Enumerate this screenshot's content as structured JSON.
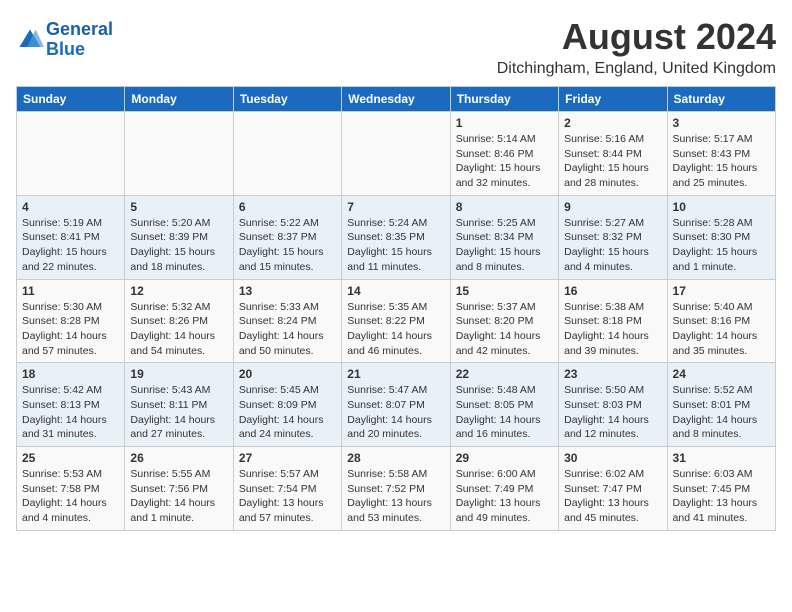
{
  "header": {
    "logo_line1": "General",
    "logo_line2": "Blue",
    "main_title": "August 2024",
    "subtitle": "Ditchingham, England, United Kingdom"
  },
  "calendar": {
    "days_of_week": [
      "Sunday",
      "Monday",
      "Tuesday",
      "Wednesday",
      "Thursday",
      "Friday",
      "Saturday"
    ],
    "weeks": [
      [
        {
          "day": "",
          "details": ""
        },
        {
          "day": "",
          "details": ""
        },
        {
          "day": "",
          "details": ""
        },
        {
          "day": "",
          "details": ""
        },
        {
          "day": "1",
          "details": "Sunrise: 5:14 AM\nSunset: 8:46 PM\nDaylight: 15 hours\nand 32 minutes."
        },
        {
          "day": "2",
          "details": "Sunrise: 5:16 AM\nSunset: 8:44 PM\nDaylight: 15 hours\nand 28 minutes."
        },
        {
          "day": "3",
          "details": "Sunrise: 5:17 AM\nSunset: 8:43 PM\nDaylight: 15 hours\nand 25 minutes."
        }
      ],
      [
        {
          "day": "4",
          "details": "Sunrise: 5:19 AM\nSunset: 8:41 PM\nDaylight: 15 hours\nand 22 minutes."
        },
        {
          "day": "5",
          "details": "Sunrise: 5:20 AM\nSunset: 8:39 PM\nDaylight: 15 hours\nand 18 minutes."
        },
        {
          "day": "6",
          "details": "Sunrise: 5:22 AM\nSunset: 8:37 PM\nDaylight: 15 hours\nand 15 minutes."
        },
        {
          "day": "7",
          "details": "Sunrise: 5:24 AM\nSunset: 8:35 PM\nDaylight: 15 hours\nand 11 minutes."
        },
        {
          "day": "8",
          "details": "Sunrise: 5:25 AM\nSunset: 8:34 PM\nDaylight: 15 hours\nand 8 minutes."
        },
        {
          "day": "9",
          "details": "Sunrise: 5:27 AM\nSunset: 8:32 PM\nDaylight: 15 hours\nand 4 minutes."
        },
        {
          "day": "10",
          "details": "Sunrise: 5:28 AM\nSunset: 8:30 PM\nDaylight: 15 hours\nand 1 minute."
        }
      ],
      [
        {
          "day": "11",
          "details": "Sunrise: 5:30 AM\nSunset: 8:28 PM\nDaylight: 14 hours\nand 57 minutes."
        },
        {
          "day": "12",
          "details": "Sunrise: 5:32 AM\nSunset: 8:26 PM\nDaylight: 14 hours\nand 54 minutes."
        },
        {
          "day": "13",
          "details": "Sunrise: 5:33 AM\nSunset: 8:24 PM\nDaylight: 14 hours\nand 50 minutes."
        },
        {
          "day": "14",
          "details": "Sunrise: 5:35 AM\nSunset: 8:22 PM\nDaylight: 14 hours\nand 46 minutes."
        },
        {
          "day": "15",
          "details": "Sunrise: 5:37 AM\nSunset: 8:20 PM\nDaylight: 14 hours\nand 42 minutes."
        },
        {
          "day": "16",
          "details": "Sunrise: 5:38 AM\nSunset: 8:18 PM\nDaylight: 14 hours\nand 39 minutes."
        },
        {
          "day": "17",
          "details": "Sunrise: 5:40 AM\nSunset: 8:16 PM\nDaylight: 14 hours\nand 35 minutes."
        }
      ],
      [
        {
          "day": "18",
          "details": "Sunrise: 5:42 AM\nSunset: 8:13 PM\nDaylight: 14 hours\nand 31 minutes."
        },
        {
          "day": "19",
          "details": "Sunrise: 5:43 AM\nSunset: 8:11 PM\nDaylight: 14 hours\nand 27 minutes."
        },
        {
          "day": "20",
          "details": "Sunrise: 5:45 AM\nSunset: 8:09 PM\nDaylight: 14 hours\nand 24 minutes."
        },
        {
          "day": "21",
          "details": "Sunrise: 5:47 AM\nSunset: 8:07 PM\nDaylight: 14 hours\nand 20 minutes."
        },
        {
          "day": "22",
          "details": "Sunrise: 5:48 AM\nSunset: 8:05 PM\nDaylight: 14 hours\nand 16 minutes."
        },
        {
          "day": "23",
          "details": "Sunrise: 5:50 AM\nSunset: 8:03 PM\nDaylight: 14 hours\nand 12 minutes."
        },
        {
          "day": "24",
          "details": "Sunrise: 5:52 AM\nSunset: 8:01 PM\nDaylight: 14 hours\nand 8 minutes."
        }
      ],
      [
        {
          "day": "25",
          "details": "Sunrise: 5:53 AM\nSunset: 7:58 PM\nDaylight: 14 hours\nand 4 minutes."
        },
        {
          "day": "26",
          "details": "Sunrise: 5:55 AM\nSunset: 7:56 PM\nDaylight: 14 hours\nand 1 minute."
        },
        {
          "day": "27",
          "details": "Sunrise: 5:57 AM\nSunset: 7:54 PM\nDaylight: 13 hours\nand 57 minutes."
        },
        {
          "day": "28",
          "details": "Sunrise: 5:58 AM\nSunset: 7:52 PM\nDaylight: 13 hours\nand 53 minutes."
        },
        {
          "day": "29",
          "details": "Sunrise: 6:00 AM\nSunset: 7:49 PM\nDaylight: 13 hours\nand 49 minutes."
        },
        {
          "day": "30",
          "details": "Sunrise: 6:02 AM\nSunset: 7:47 PM\nDaylight: 13 hours\nand 45 minutes."
        },
        {
          "day": "31",
          "details": "Sunrise: 6:03 AM\nSunset: 7:45 PM\nDaylight: 13 hours\nand 41 minutes."
        }
      ]
    ]
  }
}
